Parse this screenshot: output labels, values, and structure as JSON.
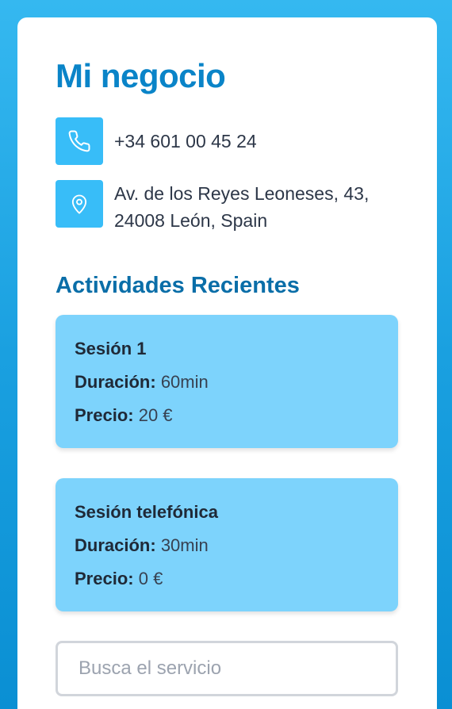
{
  "business": {
    "title": "Mi negocio",
    "phone": "+34 601 00 45 24",
    "address": "Av. de los Reyes Leoneses, 43, 24008 León, Spain",
    "phone_icon": "phone-icon",
    "address_icon": "map-pin-icon"
  },
  "activities": {
    "title": "Actividades Recientes",
    "duration_label": "Duración:",
    "price_label": "Precio:",
    "items": [
      {
        "name": "Sesión 1",
        "duration": "60min",
        "price": "20 €"
      },
      {
        "name": "Sesión telefónica",
        "duration": "30min",
        "price": "0 €"
      }
    ]
  },
  "search": {
    "placeholder": "Busca el servicio",
    "value": ""
  },
  "colors": {
    "accent": "#0a84c8",
    "icon_bg": "#38bdf8",
    "card_bg": "#7dd3fc",
    "page_bg": "#1aa0e0"
  }
}
